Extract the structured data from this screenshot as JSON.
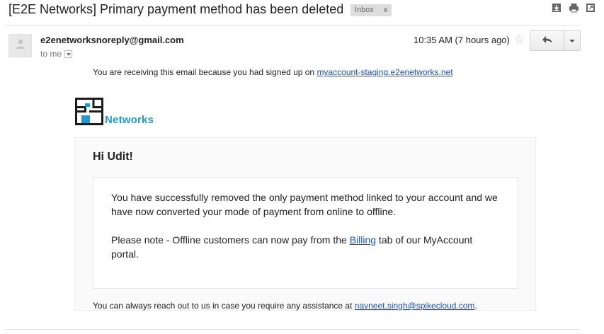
{
  "email": {
    "subject": "[E2E Networks] Primary payment method has been deleted",
    "label": "Inbox",
    "label_remove": "x",
    "sender": "e2enetworksnoreply@gmail.com",
    "recipient": "to me",
    "timestamp": "10:35 AM (7 hours ago)"
  },
  "body": {
    "receiving_prefix": "You are receiving this email because you had signed up on ",
    "receiving_link": "myaccount-staging.e2enetworks.net",
    "logo_text": "Networks",
    "greeting": "Hi Udit!",
    "paragraph1": "You have successfully removed the only payment method linked to your account and we have now converted your mode of payment from online to offline.",
    "paragraph2_prefix": "Please note - Offline customers can now pay from the ",
    "paragraph2_link": "Billing",
    "paragraph2_suffix": " tab of our MyAccount portal.",
    "footer_prefix": "You can always reach out to us in case you require any assistance at ",
    "footer_email": "navneet.singh@spikecloud.com",
    "footer_suffix": "."
  },
  "icons": {
    "download": "download-icon",
    "print": "print-icon",
    "open_new_window": "open-new-window-icon",
    "avatar": "person-icon",
    "star": "star-icon",
    "reply": "reply-icon",
    "more": "chevron-down-icon"
  },
  "colors": {
    "link": "#1155cc",
    "brand_blue": "#1a9ad6",
    "label_bg": "#dddddd"
  }
}
